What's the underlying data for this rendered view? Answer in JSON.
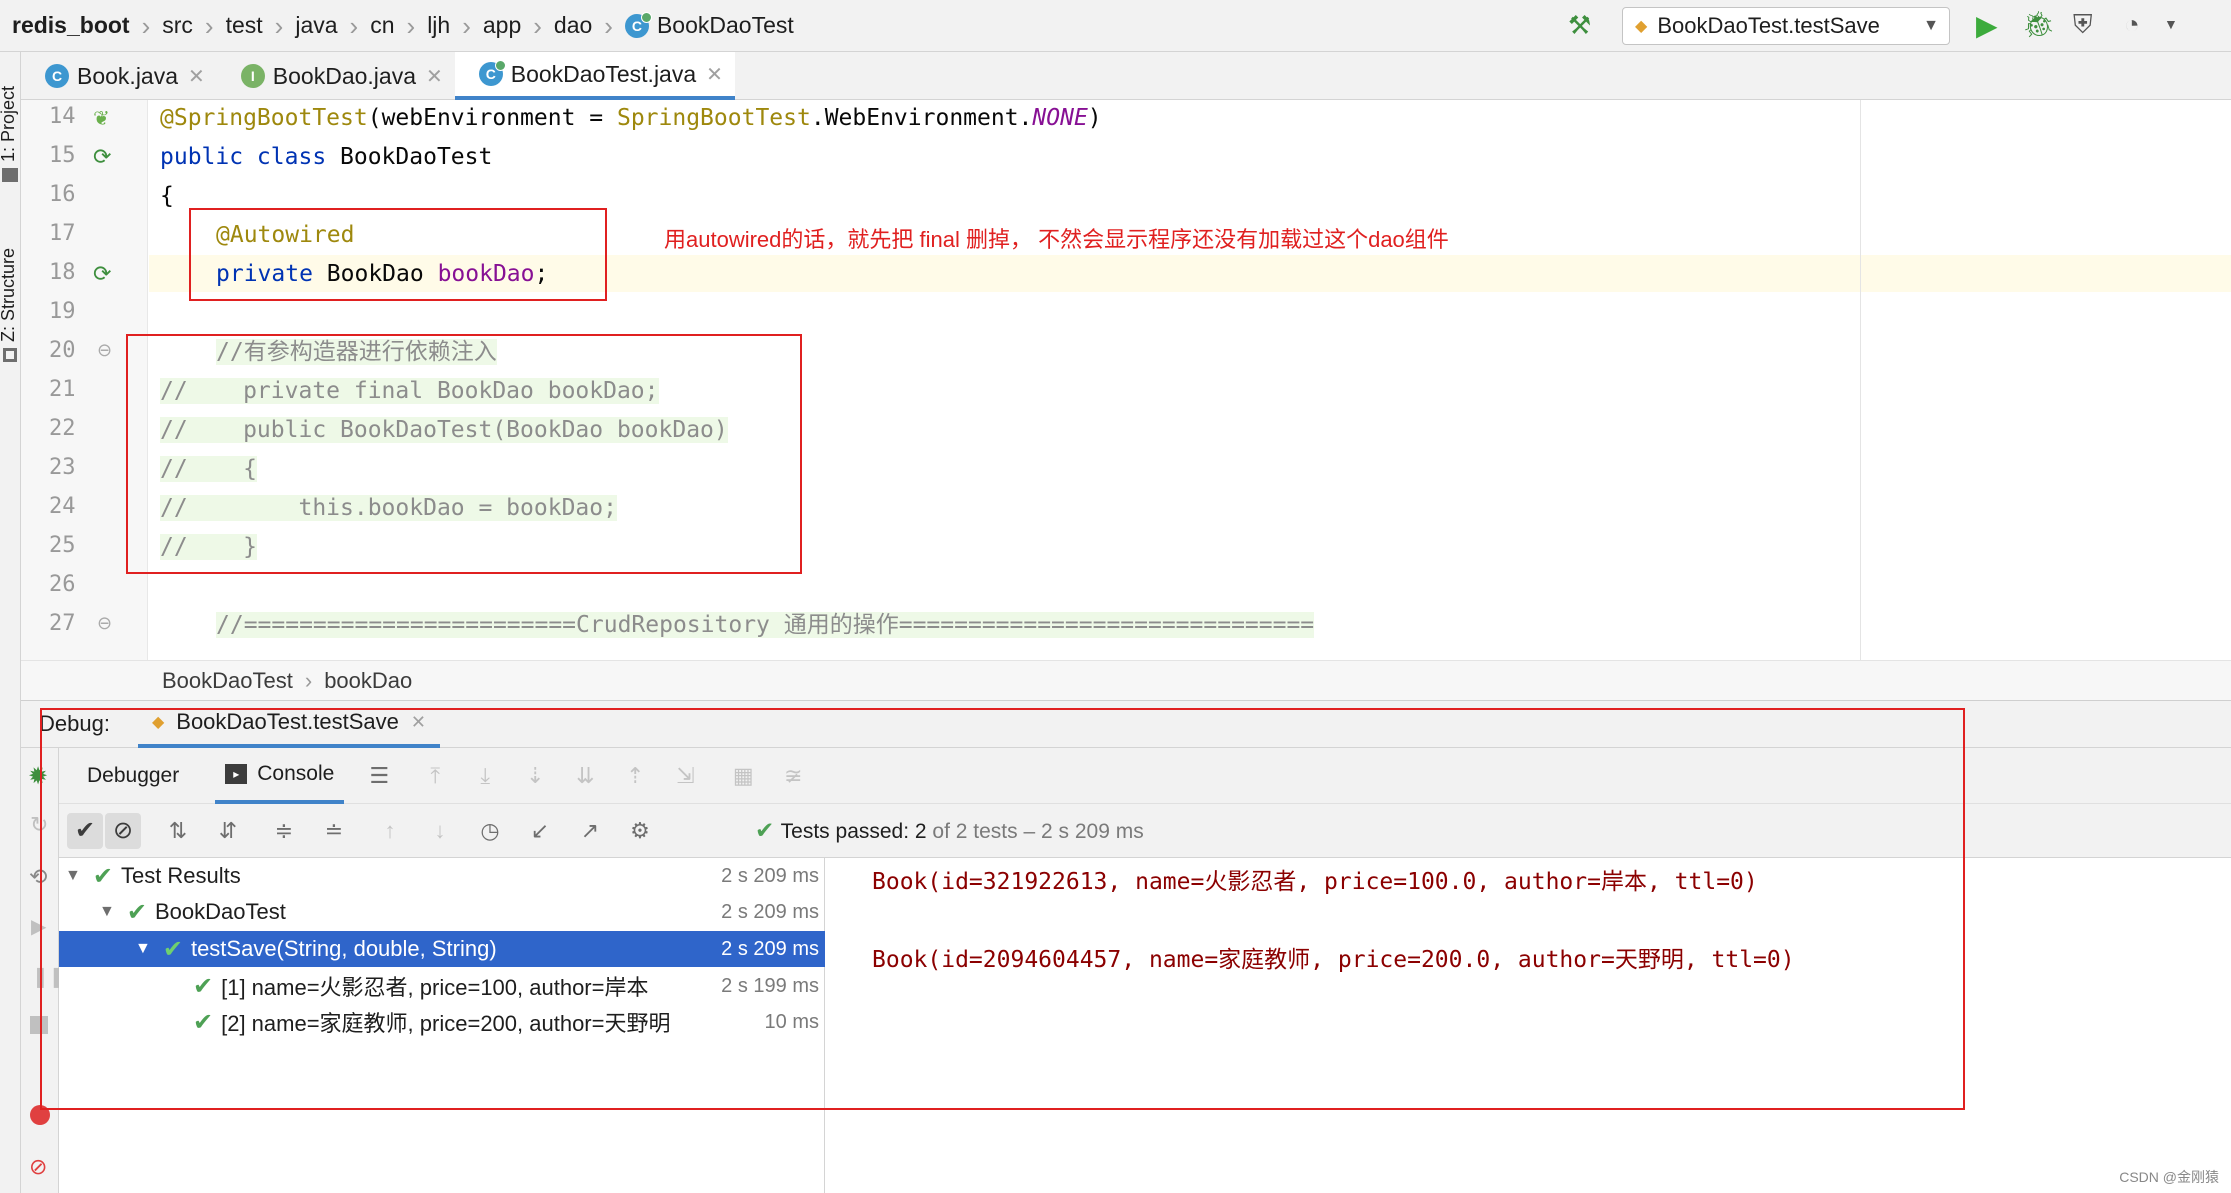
{
  "navbar": {
    "crumbs": [
      "redis_boot",
      "src",
      "test",
      "java",
      "cn",
      "ljh",
      "app",
      "dao",
      "BookDaoTest"
    ],
    "run_config": "BookDaoTest.testSave"
  },
  "left_strip": {
    "project_label": "1: Project",
    "structure_label": "Z: Structure"
  },
  "tabs": [
    {
      "label": "Book.java",
      "icon": "class-icon"
    },
    {
      "label": "BookDao.java",
      "icon": "interface-icon"
    },
    {
      "label": "BookDaoTest.java",
      "icon": "test-class-icon",
      "active": true
    }
  ],
  "editor": {
    "line_numbers": [
      "14",
      "15",
      "16",
      "17",
      "18",
      "19",
      "20",
      "21",
      "22",
      "23",
      "24",
      "25",
      "26",
      "27"
    ],
    "lines": {
      "l14_ann": "@SpringBootTest",
      "l14_a": "(webEnvironment = ",
      "l14_cls": "SpringBootTest",
      "l14_b": ".WebEnvironment.",
      "l14_none": "NONE",
      "l14_c": ")",
      "l15_kw": "public class",
      "l15_name": " BookDaoTest",
      "l16": "{",
      "l17_ann": "@Autowired",
      "l18_kw": "private",
      "l18_type": " BookDao ",
      "l18_field": "bookDao",
      "l18_end": ";",
      "l20": "//有参构造器进行依赖注入",
      "l21": "//    private final BookDao bookDao;",
      "l22": "//    public BookDaoTest(BookDao bookDao)",
      "l23": "//    {",
      "l24": "//        this.bookDao = bookDao;",
      "l25": "//    }",
      "l27": "//========================CrudRepository 通用的操作=============================="
    },
    "breadcrumb": [
      "BookDaoTest",
      "bookDao"
    ]
  },
  "annotation_note": "用autowired的话，就先把 final 删掉， 不然会显示程序还没有加载过这个dao组件",
  "debug": {
    "label": "Debug:",
    "session_tab": "BookDaoTest.testSave",
    "subtabs": {
      "debugger": "Debugger",
      "console": "Console"
    },
    "status_prefix": "Tests passed: ",
    "status_count": "2",
    "status_suffix": " of 2 tests – 2 s 209 ms",
    "tree": [
      {
        "label": "Test Results",
        "time": "2 s 209 ms"
      },
      {
        "label": "BookDaoTest",
        "time": "2 s 209 ms"
      },
      {
        "label": "testSave(String, double, String)",
        "time": "2 s 209 ms"
      },
      {
        "label": "[1] name=火影忍者, price=100, author=岸本",
        "time": "2 s 199 ms"
      },
      {
        "label": "[2] name=家庭教师, price=200, author=天野明",
        "time": "10 ms"
      }
    ],
    "console": [
      "Book(id=321922613, name=火影忍者, price=100.0, author=岸本, ttl=0)",
      "Book(id=2094604457, name=家庭教师, price=200.0, author=天野明, ttl=0)"
    ]
  },
  "watermark": "CSDN @金刚猿",
  "colors": {
    "accent": "#2f65ca",
    "annotation_red": "#e02020",
    "pass_green": "#4ea155"
  }
}
